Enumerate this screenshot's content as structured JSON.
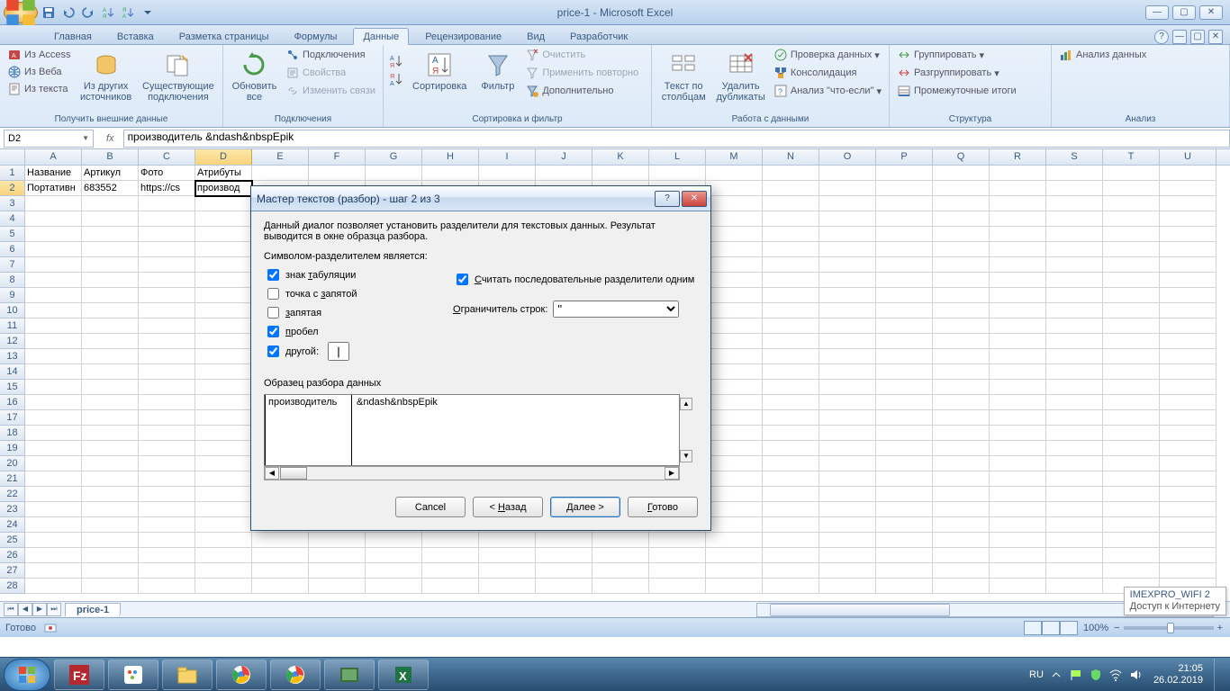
{
  "window": {
    "title": "price-1 - Microsoft Excel"
  },
  "tabs": {
    "home": "Главная",
    "insert": "Вставка",
    "pagelayout": "Разметка страницы",
    "formulas": "Формулы",
    "data": "Данные",
    "review": "Рецензирование",
    "view": "Вид",
    "developer": "Разработчик"
  },
  "ribbon": {
    "ext": {
      "access": "Из Access",
      "web": "Из Веба",
      "text": "Из текста",
      "other": "Из других источников",
      "existing": "Существующие подключения",
      "group": "Получить внешние данные"
    },
    "conn": {
      "refresh": "Обновить все",
      "connections": "Подключения",
      "properties": "Свойства",
      "editlinks": "Изменить связи",
      "group": "Подключения"
    },
    "sort": {
      "sort": "Сортировка",
      "filter": "Фильтр",
      "clear": "Очистить",
      "reapply": "Применить повторно",
      "advanced": "Дополнительно",
      "group": "Сортировка и фильтр"
    },
    "tools": {
      "t2c": "Текст по столбцам",
      "dup": "Удалить дубликаты",
      "valid": "Проверка данных",
      "consol": "Консолидация",
      "whatif": "Анализ \"что-если\"",
      "group": "Работа с данными"
    },
    "outline": {
      "grp": "Группировать",
      "ungrp": "Разгруппировать",
      "subtot": "Промежуточные итоги",
      "group": "Структура"
    },
    "analysis": {
      "btn": "Анализ данных",
      "group": "Анализ"
    }
  },
  "namebox": "D2",
  "formula": "производитель &ndash&nbspEpik",
  "headers": [
    "A",
    "B",
    "C",
    "D",
    "E",
    "F",
    "G",
    "H",
    "I",
    "J",
    "K",
    "L",
    "M",
    "N",
    "O",
    "P",
    "Q",
    "R",
    "S",
    "T",
    "U"
  ],
  "row1": {
    "A": "Название",
    "B": "Артикул",
    "C": "Фото",
    "D": "Атрибуты"
  },
  "row2": {
    "A": "Портативн",
    "B": "683552",
    "C": "https://cs",
    "D": "производ"
  },
  "sheet": "price-1",
  "status": "Готово",
  "zoom": "100%",
  "wifi": {
    "ssid": "IMEXPRO_WIFI 2",
    "sub": "Доступ к Интернету"
  },
  "lang": "RU",
  "clock": {
    "time": "21:05",
    "date": "26.02.2019"
  },
  "dialog": {
    "title": "Мастер текстов (разбор) - шаг 2 из 3",
    "desc": "Данный диалог позволяет установить разделители для текстовых данных. Результат выводится в окне образца разбора.",
    "legend": "Символом-разделителем является:",
    "tab": "знак табуляции",
    "semicolon": "точка с запятой",
    "comma": "запятая",
    "space": "пробел",
    "other": "другой:",
    "other_val": "|",
    "consecutive": "Считать последовательные разделители одним",
    "qualifier_label": "Ограничитель строк:",
    "qualifier": "\"",
    "preview_label": "Образец разбора данных",
    "preview_col1": "производитель",
    "preview_col2": "&ndash&nbspEpik",
    "btn_cancel": "Cancel",
    "btn_back": "< Назад",
    "btn_next": "Далее >",
    "btn_finish": "Готово"
  }
}
